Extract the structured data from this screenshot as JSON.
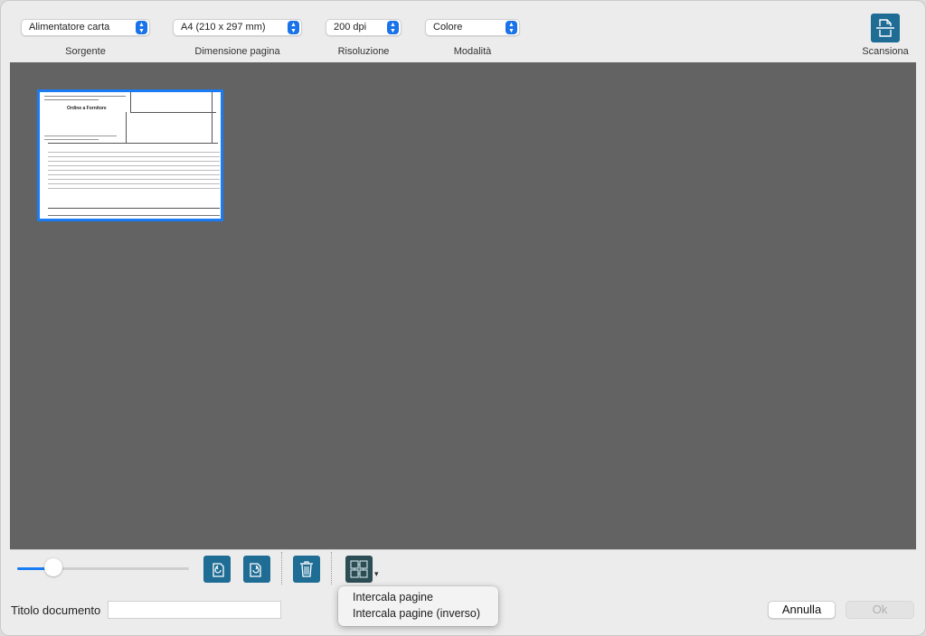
{
  "toolbar": {
    "source": {
      "value": "Alimentatore carta",
      "label": "Sorgente"
    },
    "page_size": {
      "value": "A4 (210 x 297 mm)",
      "label": "Dimensione pagina"
    },
    "resolution": {
      "value": "200 dpi",
      "label": "Risoluzione"
    },
    "mode": {
      "value": "Colore",
      "label": "Modalità"
    },
    "scan_label": "Scansiona"
  },
  "preview": {
    "thumbnail_title": "Ordine a Fornitore",
    "selected_page": 1
  },
  "bottom": {
    "zoom_fraction": 0.21,
    "buttons": [
      "rotate-left-icon",
      "rotate-right-icon",
      "trash-icon",
      "interleave-icon"
    ]
  },
  "footer": {
    "title_label": "Titolo documento",
    "title_value": "",
    "cancel_label": "Annulla",
    "ok_label": "Ok"
  },
  "menu": {
    "items": [
      "Intercala pagine",
      "Intercala pagine (inverso)"
    ]
  },
  "colors": {
    "accent": "#1a7cf5",
    "tool_button": "#1f6c95",
    "preview_bg": "#636363"
  }
}
